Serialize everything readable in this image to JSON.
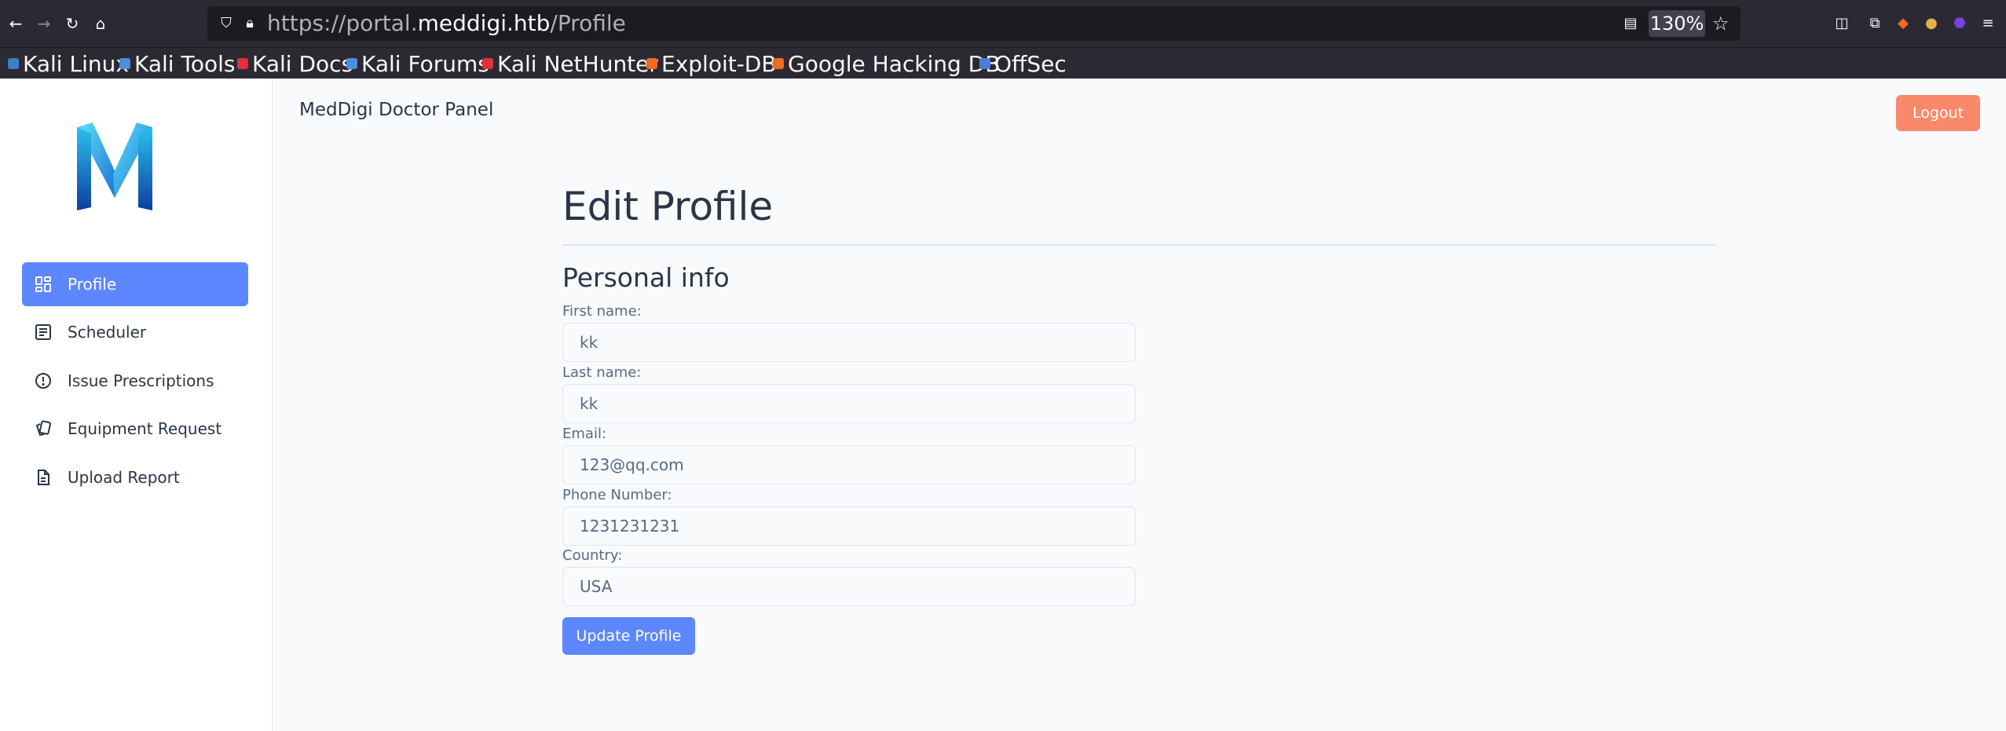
{
  "browser": {
    "url_prefix": "https://portal.",
    "url_host": "meddigi.htb",
    "url_path": "/Profile",
    "zoom": "130%",
    "bookmarks": [
      {
        "label": "Kali Linux",
        "color": "#3a80c6"
      },
      {
        "label": "Kali Tools",
        "color": "#4b8fd9"
      },
      {
        "label": "Kali Docs",
        "color": "#e0313c"
      },
      {
        "label": "Kali Forums",
        "color": "#4b8fd9"
      },
      {
        "label": "Kali NetHunter",
        "color": "#e0313c"
      },
      {
        "label": "Exploit-DB",
        "color": "#f06a23"
      },
      {
        "label": "Google Hacking DB",
        "color": "#f06a23"
      },
      {
        "label": "OffSec",
        "color": "#4f7bd9"
      }
    ]
  },
  "sidebar": {
    "logo": "meddigi-m-logo",
    "items": [
      {
        "label": "Profile",
        "icon": "dashboard-icon",
        "active": true
      },
      {
        "label": "Scheduler",
        "icon": "list-icon",
        "active": false
      },
      {
        "label": "Issue Prescriptions",
        "icon": "alert-circle-icon",
        "active": false
      },
      {
        "label": "Equipment Request",
        "icon": "cards-icon",
        "active": false
      },
      {
        "label": "Upload Report",
        "icon": "file-icon",
        "active": false
      }
    ]
  },
  "header": {
    "title": "MedDigi Doctor Panel",
    "logout_label": "Logout"
  },
  "form": {
    "heading": "Edit Profile",
    "section": "Personal info",
    "fields": [
      {
        "label": "First name:",
        "value": "kk"
      },
      {
        "label": "Last name:",
        "value": "kk"
      },
      {
        "label": "Email:",
        "value": "123@qq.com"
      },
      {
        "label": "Phone Number:",
        "value": "1231231231"
      },
      {
        "label": "Country:",
        "value": "USA"
      }
    ],
    "submit_label": "Update Profile"
  },
  "colors": {
    "primary": "#5d87ff",
    "logout": "#fa896b",
    "text": "#2a3547",
    "muted": "#5a6a85"
  }
}
